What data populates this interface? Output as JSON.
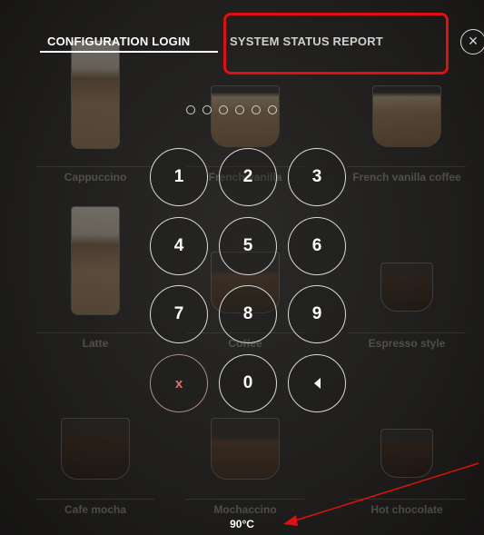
{
  "tabs": {
    "login": "CONFIGURATION LOGIN",
    "status": "SYSTEM STATUS REPORT"
  },
  "close_icon": "×",
  "pin": {
    "length": 6,
    "entered": 0
  },
  "keypad": {
    "k1": "1",
    "k2": "2",
    "k3": "3",
    "k4": "4",
    "k5": "5",
    "k6": "6",
    "k7": "7",
    "k8": "8",
    "k9": "9",
    "cancel": "x",
    "k0": "0",
    "backspace_icon": "backspace-icon"
  },
  "drinks": {
    "d1": "Cappuccino",
    "d2": "French vanilla",
    "d3": "French vanilla coffee",
    "d4": "Latte",
    "d5": "Coffee",
    "d6": "Espresso style",
    "d7": "Cafe mocha",
    "d8": "Mochaccino",
    "d9": "Hot chocolate"
  },
  "temperature": "90°C",
  "colors": {
    "highlight": "#e01010",
    "arrow": "#e01010",
    "cancel_key": "#e07070"
  }
}
